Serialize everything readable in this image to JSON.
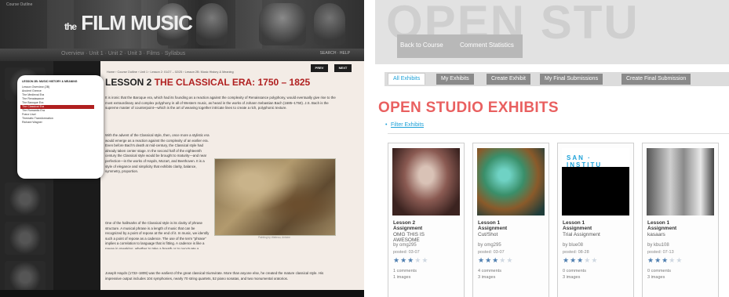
{
  "left": {
    "header": {
      "small_caption": "Course Outline",
      "title_main": "FILM MUSIC",
      "title_prefix": "the"
    },
    "nav": {
      "items_text": "Overview · Unit 1 · Unit 2 · Unit 3 · Films · Syllabus",
      "right_links": "SEARCH · HELP"
    },
    "sidebar": {
      "heading": "LESSON 2B: MUSIC HISTORY & MEANING",
      "items": [
        "Lesson Overview (2B)",
        "Ancient Greece",
        "The Medieval Era",
        "The Renaissance",
        "The Baroque Era",
        "The Classical Era",
        "The Romantic Era",
        "Franz Liszt",
        "Thematic Transformation",
        "Richard Wagner"
      ],
      "active_index": 5
    },
    "content": {
      "breadcrumb": "Home › Course Outline › Unit 1 › Lesson 2: 01/27 – 02/25 › Lesson 2B: Music History & Meaning",
      "prev_label": "PREV",
      "next_label": "NEXT",
      "lesson_label": "LESSON 2",
      "lesson_title": "THE CLASSICAL ERA: 1750 – 1825",
      "para1": "It is ironic that the Baroque era, which had its founding as a reaction against the complexity of Renaissance polyphony, would eventually give rise to the most extraordinary and complex polyphony in all of Western music, as heard in the works of Johann Sebastian Bach (1685–1750). J.S. Bach is the supreme master of counterpoint—which is the art of weaving together intricate lines to create a rich, polyphonic texture.",
      "para2": "With the advent of the Classical style, then, once more a stylistic era would emerge as a reaction against the complexity of an earlier era. Even before Bach's death at mid-century, the Classical style had already taken center stage. In the second half of the eighteenth century the Classical style would be brought to maturity—and near perfection—in the works of Haydn, Mozart, and Beethoven. It is a style of elegance and simplicity that exhibits clarity, balance, symmetry, proportion.",
      "para3": "One of the hallmarks of the Classical style is its clarity of phrase structure. A musical phrase is a length of music that can be recognized by a point of repose at the end of it. In music, we identify such a point of repose as a cadence. The use of the term \"phrase\" implies a correlation to language that is fitting. A cadence is like a pause in speaking, whether to take a breath or to punctuate a sentence. There are even two types of cadences, inconclusive and conclusive, that correspond rather nicely to the comma and the period.",
      "para4": "Joseph Haydn (1732–1809) was the earliest of the great classical triumvirate. More than anyone else, he created the mature classical style. His impressive output includes 104 symphonies, nearly 70 string quartets, 52 piano sonatas, and two monumental oratorios.",
      "caption": "Painting by Watteau, Antoine"
    }
  },
  "right": {
    "banner": {
      "big_text": "OPEN STU",
      "back_label": "Back to Course",
      "comment_label": "Comment Statistics"
    },
    "tabs": [
      "All Exhibits",
      "My Exhibits",
      "Create Exhibit",
      "My Final Submissions",
      "Create Final Submission"
    ],
    "active_tab": 0,
    "title": "OPEN STUDIO EXHIBITS",
    "filter_label": "Filter Exhibits",
    "cards": [
      {
        "lesson": "Lesson 2",
        "assign": "Assignment",
        "name": "OMG THIS IS",
        "name2": "AWESOME",
        "by": "by omg295",
        "posted": "posted: 03-07",
        "rating": 3,
        "comments": "1 comments",
        "images": "1 images"
      },
      {
        "lesson": "Lesson 1",
        "assign": "Assignment",
        "name": "Cut/Shot",
        "name2": "",
        "by": "by omg295",
        "posted": "posted: 03-07",
        "rating": 3,
        "comments": "4 comments",
        "images": "3 images"
      },
      {
        "lesson": "Lesson 1",
        "assign": "Assignment",
        "name": "Trial Assignment",
        "name2": "",
        "by": "by blue08",
        "posted": "posted: 08-28",
        "rating": 3,
        "comments": "0 comments",
        "images": "3 images"
      },
      {
        "lesson": "Lesson 1",
        "assign": "Assignment",
        "name": "kasaars",
        "name2": "",
        "by": "by kbu108",
        "posted": "posted: 07-13",
        "rating": 3,
        "comments": "0 comments",
        "images": "3 images"
      }
    ],
    "card_thumb_texts": [
      "",
      "",
      "SAN · INSTITU",
      ""
    ]
  }
}
